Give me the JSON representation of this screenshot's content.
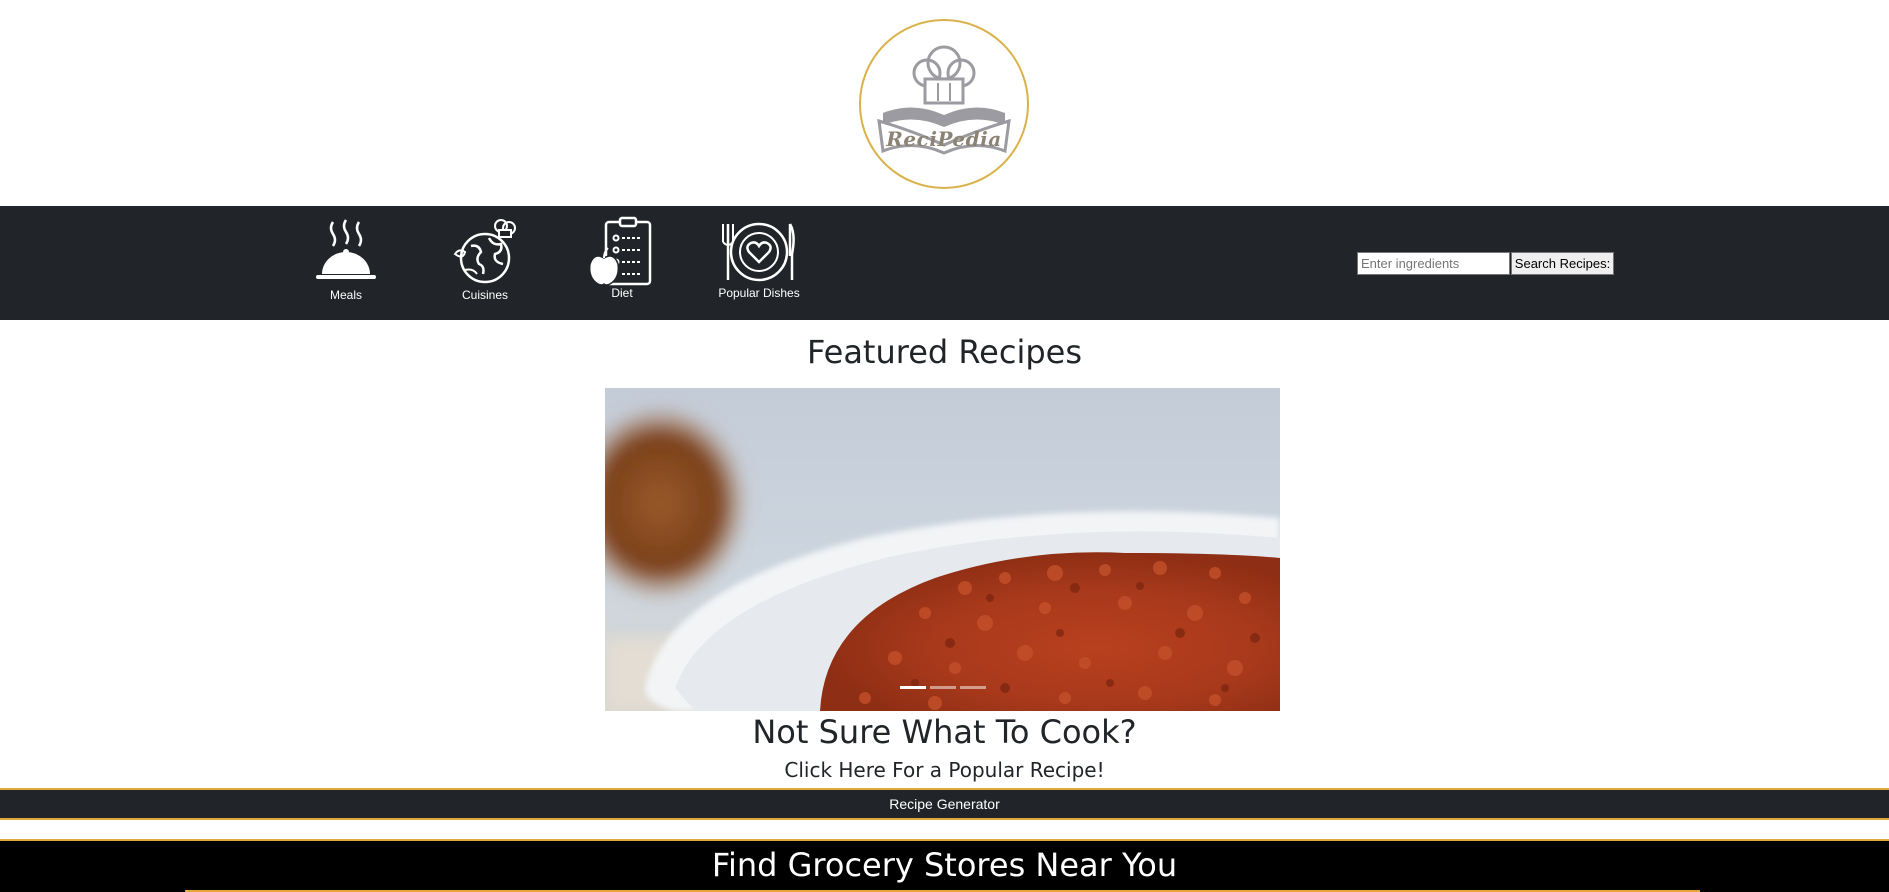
{
  "logo": {
    "text": "ReciPedia",
    "accent_color": "#d9b24a"
  },
  "nav": {
    "items": [
      {
        "label": "Meals",
        "icon": "cloche-icon"
      },
      {
        "label": "Cuisines",
        "icon": "globe-chef-hat-icon"
      },
      {
        "label": "Diet",
        "icon": "clipboard-apple-icon"
      },
      {
        "label": "Popular Dishes",
        "icon": "plate-fork-knife-icon"
      }
    ],
    "background": "#212529"
  },
  "search": {
    "placeholder": "Enter ingredients",
    "value": "",
    "button_label": "Search Recipes:"
  },
  "featured": {
    "title": "Featured Recipes",
    "slide_count": 3,
    "active_slide": 1
  },
  "cook": {
    "title": "Not Sure What To Cook?",
    "subtitle": "Click Here For a Popular Recipe!"
  },
  "generator": {
    "label": "Recipe Generator"
  },
  "grocery": {
    "title": "Find Grocery Stores Near You"
  },
  "colors": {
    "accent_gold": "#e0a93a",
    "dark": "#212529"
  }
}
